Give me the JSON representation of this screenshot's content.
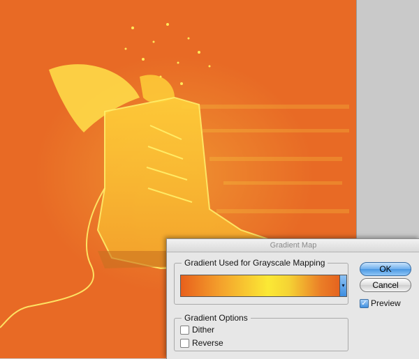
{
  "dialog": {
    "title": "Gradient Map",
    "gradient_group_label": "Gradient Used for Grayscale Mapping",
    "options_group_label": "Gradient Options",
    "dither_label": "Dither",
    "dither_checked": false,
    "reverse_label": "Reverse",
    "reverse_checked": false,
    "ok_label": "OK",
    "cancel_label": "Cancel",
    "preview_label": "Preview",
    "preview_checked": true,
    "gradient_colors": [
      "#e8601c",
      "#f4a12c",
      "#fbe935",
      "#f5d334",
      "#eb7f27",
      "#e5631f"
    ],
    "dropdown_arrow": "▾",
    "preview_check": "✓"
  },
  "canvas": {
    "background_color": "#e86a25",
    "image_subject": "boot-with-wings"
  }
}
